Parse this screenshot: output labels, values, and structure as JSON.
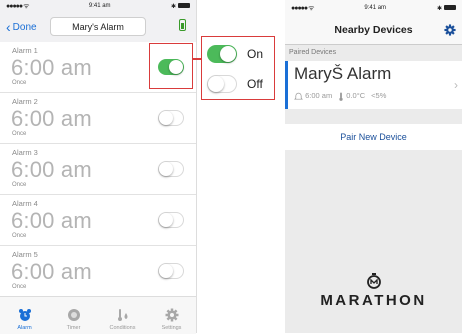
{
  "left_screen": {
    "status": {
      "signal": "●●●●● ᯤ",
      "time": "9:41 am",
      "bt": "✱"
    },
    "nav": {
      "back_label": "Done",
      "title": "Mary's Alarm"
    },
    "alarms": [
      {
        "label": "Alarm 1",
        "time": "6:00 am",
        "repeat": "Once",
        "enabled": true
      },
      {
        "label": "Alarm 2",
        "time": "6:00 am",
        "repeat": "Once",
        "enabled": false
      },
      {
        "label": "Alarm 3",
        "time": "6:00 am",
        "repeat": "Once",
        "enabled": false
      },
      {
        "label": "Alarm 4",
        "time": "6:00 am",
        "repeat": "Once",
        "enabled": false
      },
      {
        "label": "Alarm 5",
        "time": "6:00 am",
        "repeat": "Once",
        "enabled": false
      }
    ],
    "tabs": [
      {
        "label": "Alarm",
        "icon": "alarm-clock-icon",
        "active": true
      },
      {
        "label": "Timer",
        "icon": "timer-icon",
        "active": false
      },
      {
        "label": "Conditions",
        "icon": "conditions-icon",
        "active": false
      },
      {
        "label": "Settings",
        "icon": "gear-icon",
        "active": false
      }
    ]
  },
  "legend": {
    "on_label": "On",
    "off_label": "Off"
  },
  "right_screen": {
    "status": {
      "signal": "●●●●● ᯤ",
      "time": "9:41 am",
      "bt": "✱"
    },
    "nav": {
      "title": "Nearby Devices"
    },
    "section_header": "Paired Devices",
    "device": {
      "name": "MaryŠ Alarm",
      "time": "6:00 am",
      "temperature": "0.0°C",
      "humidity": "<5%"
    },
    "pair_button": "Pair New Device",
    "brand": "MARATHON"
  },
  "colors": {
    "accent": "#1a6fd6",
    "toggle_on": "#4cba5a",
    "highlight": "#d93b3b",
    "battery": "#3a9a2a"
  }
}
